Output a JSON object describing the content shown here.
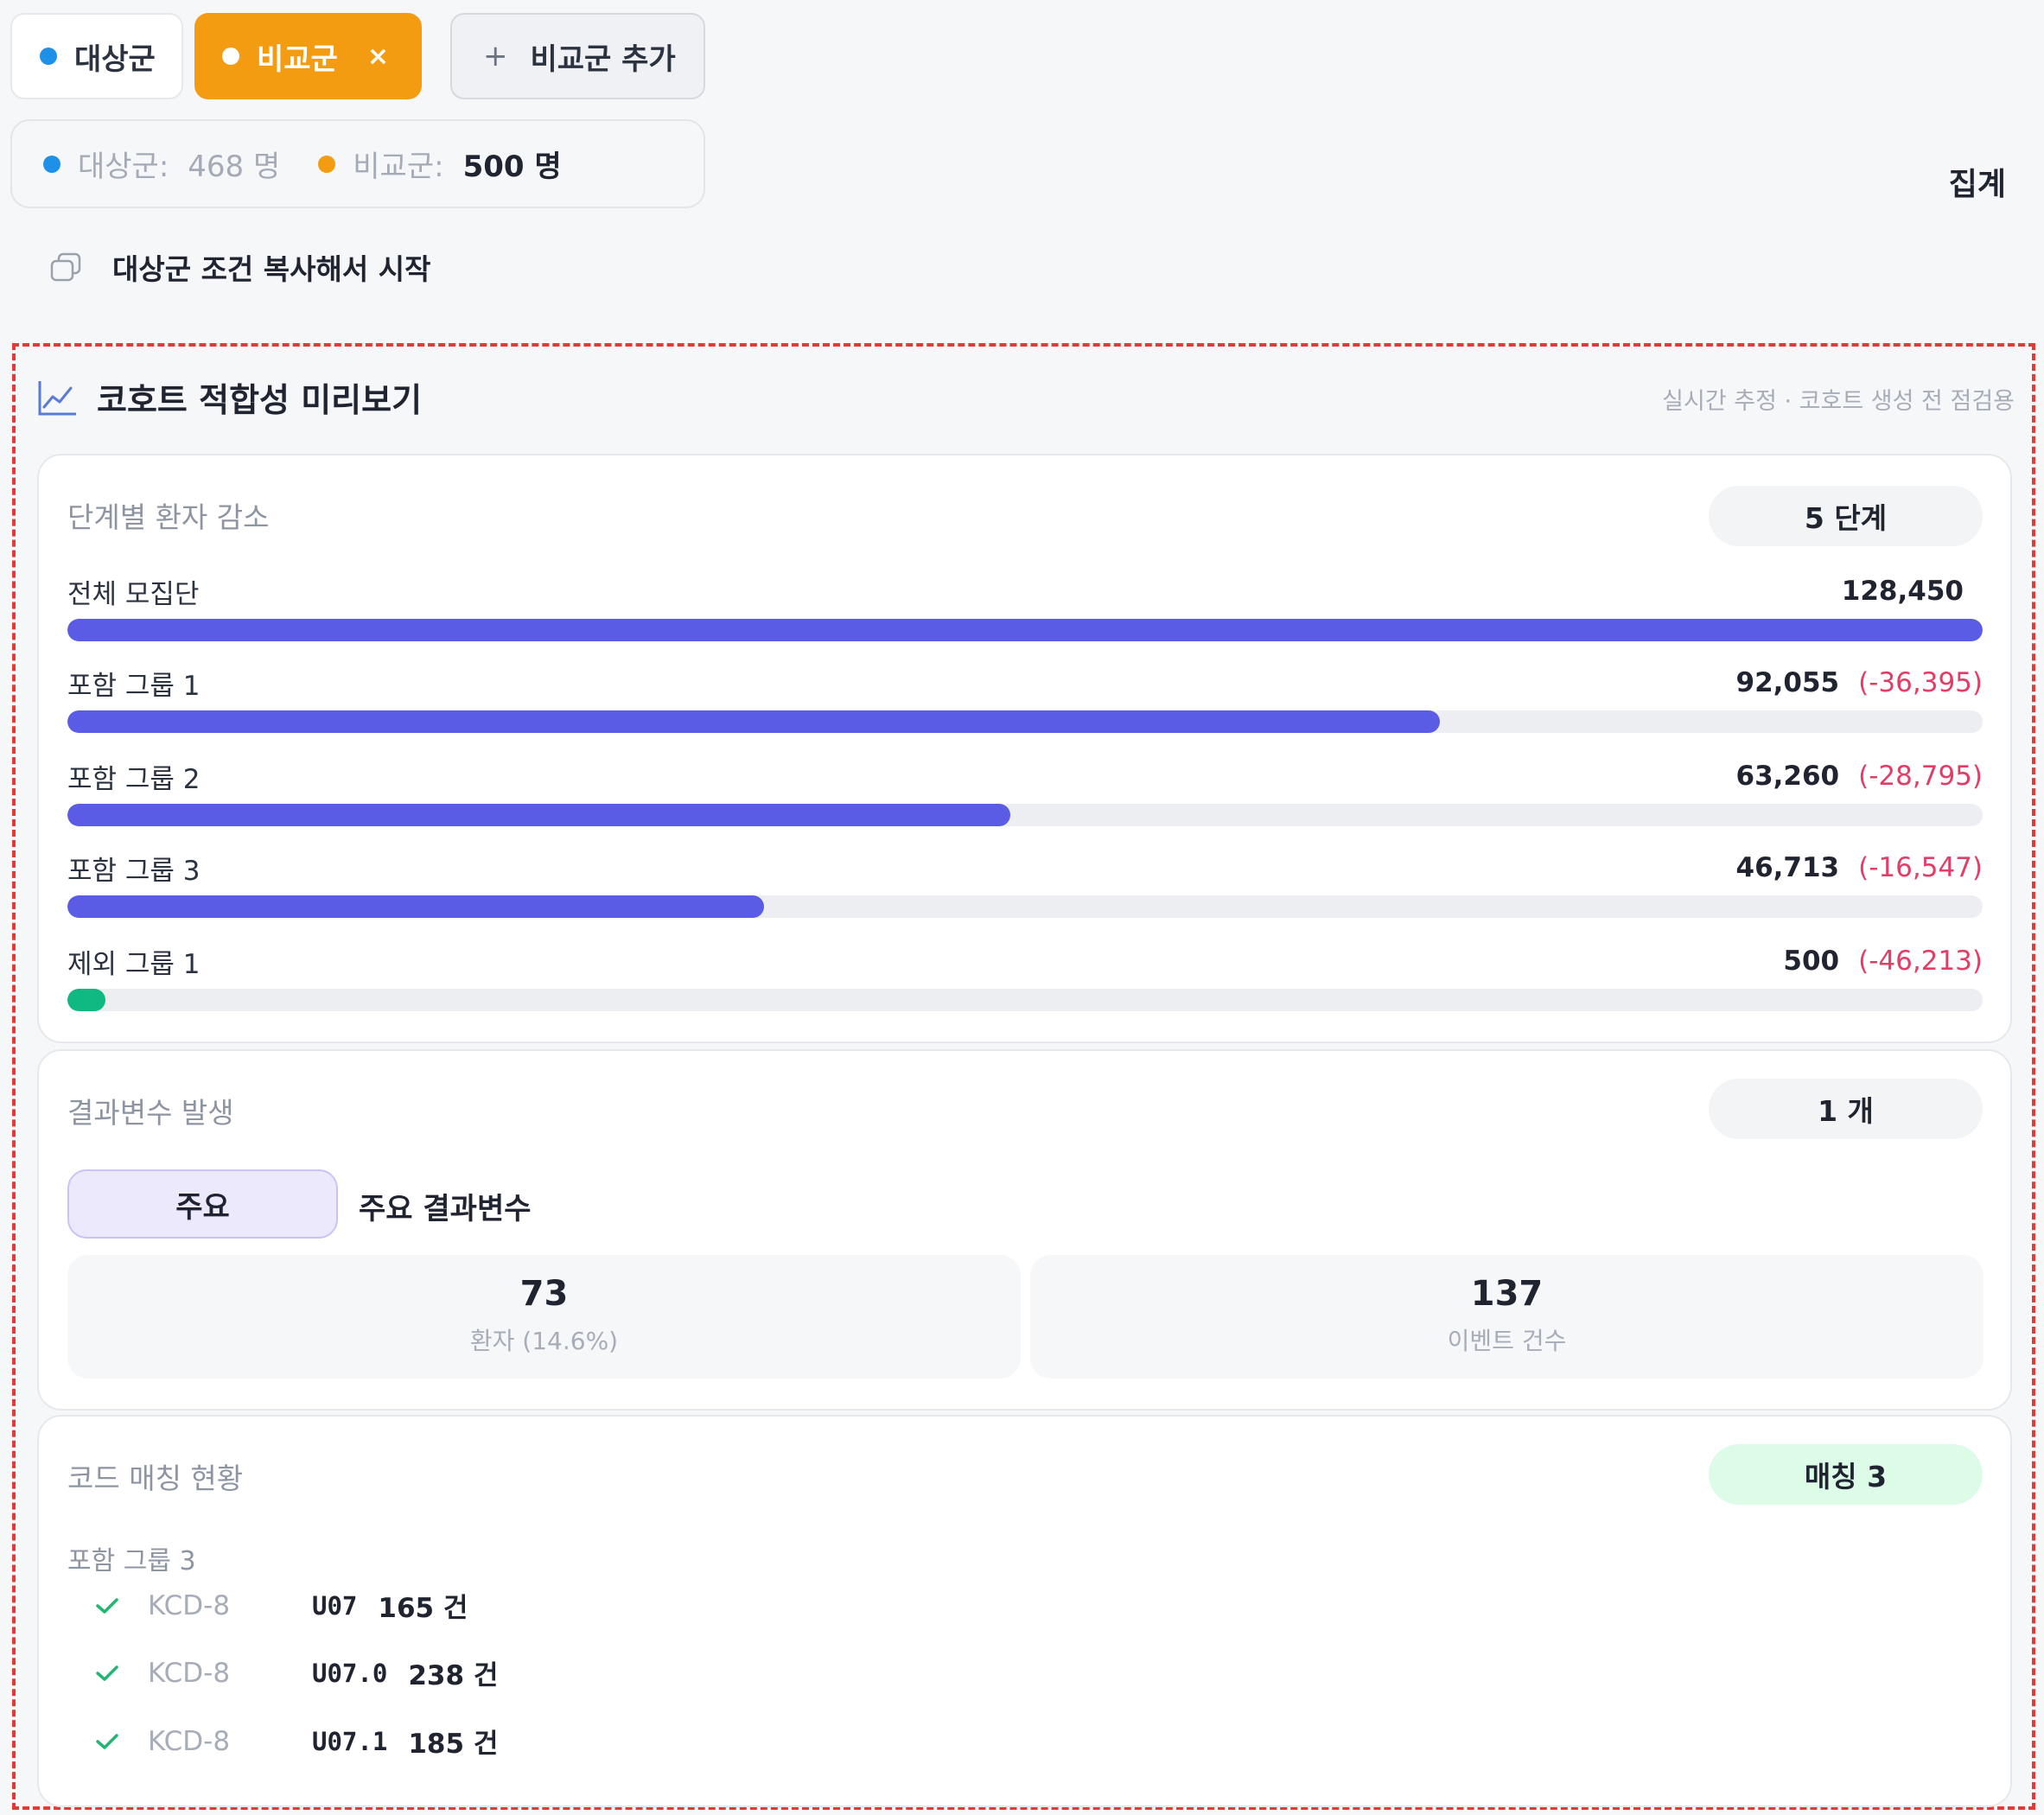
{
  "tabs": {
    "target": {
      "label": "대상군"
    },
    "compare": {
      "label": "비교군",
      "close": "×"
    },
    "add": {
      "label": "비교군 추가",
      "plus": "+"
    }
  },
  "counts": {
    "target_label": "대상군:",
    "target_value": "468 명",
    "compare_label": "비교군:",
    "compare_value": "500 명"
  },
  "aggregate_label": "집계",
  "copy_action": {
    "label": "대상군 조건 복사해서 시작",
    "icon": "copy-icon"
  },
  "preview": {
    "title": "코호트 적합성 미리보기",
    "subtitle": "실시간 추정 · 코호트 생성 전 점검용",
    "icon": "line-chart-icon"
  },
  "funnel": {
    "title": "단계별 환자 감소",
    "badge": "5 단계",
    "rows": [
      {
        "label": "전체 모집단",
        "count": "128,450",
        "delta": "",
        "ratio": 1.0,
        "color": "#5b5ce6"
      },
      {
        "label": "포함 그룹 1",
        "count": "92,055",
        "delta": "(-36,395)",
        "ratio": 0.7167,
        "color": "#5b5ce6"
      },
      {
        "label": "포함 그룹 2",
        "count": "63,260",
        "delta": "(-28,795)",
        "ratio": 0.4925,
        "color": "#5b5ce6"
      },
      {
        "label": "포함 그룹 3",
        "count": "46,713",
        "delta": "(-16,547)",
        "ratio": 0.3637,
        "color": "#5b5ce6"
      },
      {
        "label": "제외 그룹 1",
        "count": "500",
        "delta": "(-46,213)",
        "ratio": 0.0039,
        "color": "#10b981"
      }
    ]
  },
  "outcomes": {
    "title": "결과변수 발생",
    "badge": "1 개",
    "primary_badge": "주요",
    "outcome_name": "주요 결과변수",
    "stats": [
      {
        "value": "73",
        "label": "환자 (14.6%)"
      },
      {
        "value": "137",
        "label": "이벤트 건수"
      }
    ]
  },
  "code_match": {
    "title": "코드 매칭 현황",
    "badge": "매칭 3",
    "group_label": "포함 그룹 3",
    "rows": [
      {
        "system": "KCD-8",
        "code": "U07",
        "count": "165 건"
      },
      {
        "system": "KCD-8",
        "code": "U07.0",
        "count": "238 건"
      },
      {
        "system": "KCD-8",
        "code": "U07.1",
        "count": "185 건"
      }
    ]
  }
}
